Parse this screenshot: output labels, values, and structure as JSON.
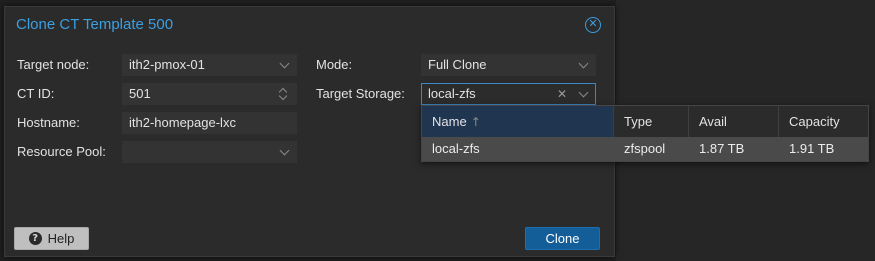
{
  "dialog": {
    "title": "Clone CT Template 500"
  },
  "form": {
    "target_node": {
      "label": "Target node:",
      "value": "ith2-pmox-01"
    },
    "ct_id": {
      "label": "CT ID:",
      "value": "501"
    },
    "hostname": {
      "label": "Hostname:",
      "value": "ith2-homepage-lxc"
    },
    "resource_pool": {
      "label": "Resource Pool:",
      "value": ""
    },
    "mode": {
      "label": "Mode:",
      "value": "Full Clone"
    },
    "target_storage": {
      "label": "Target Storage:",
      "value": "local-zfs"
    }
  },
  "buttons": {
    "help": "Help",
    "clone": "Clone"
  },
  "storage_dropdown": {
    "columns": [
      "Name",
      "Type",
      "Avail",
      "Capacity"
    ],
    "sort_column": "Name",
    "sort_direction": "ascending",
    "rows": [
      {
        "name": "local-zfs",
        "type": "zfspool",
        "avail": "1.87 TB",
        "capacity": "1.91 TB",
        "selected": true
      }
    ]
  },
  "colors": {
    "accent": "#3b9fe0",
    "primary_button": "#135d99",
    "selected_row": "#4a4a4a",
    "sorted_header": "#203550"
  },
  "icons": [
    "close-circle-icon",
    "chevron-down-icon",
    "spinner-icon",
    "clear-icon",
    "help-icon",
    "sort-ascending-icon"
  ]
}
